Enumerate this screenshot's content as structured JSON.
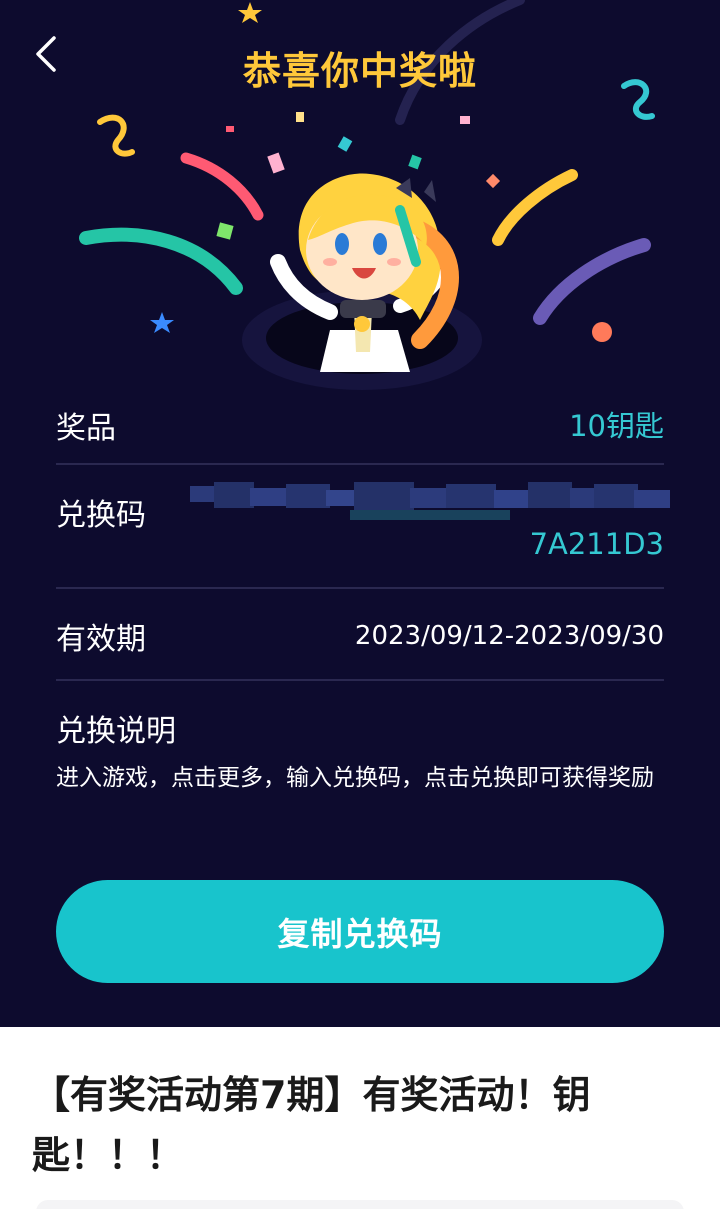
{
  "header": {
    "title": "恭喜你中奖啦"
  },
  "prize": {
    "label": "奖品",
    "value": "10钥匙"
  },
  "code": {
    "label": "兑换码",
    "value_visible_tail": "7A211D3"
  },
  "validity": {
    "label": "有效期",
    "value": "2023/09/12-2023/09/30"
  },
  "instructions": {
    "label": "兑换说明",
    "text": "进入游戏，点击更多，输入兑换码，点击兑换即可获得奖励"
  },
  "actions": {
    "copy_label": "复制兑换码"
  },
  "article": {
    "title": "【有奖活动第7期】有奖活动！钥匙！！！"
  },
  "colors": {
    "background": "#0d0b2e",
    "title": "#ffc83a",
    "accent": "#18c4cc",
    "value_blue": "#35c8d2"
  }
}
